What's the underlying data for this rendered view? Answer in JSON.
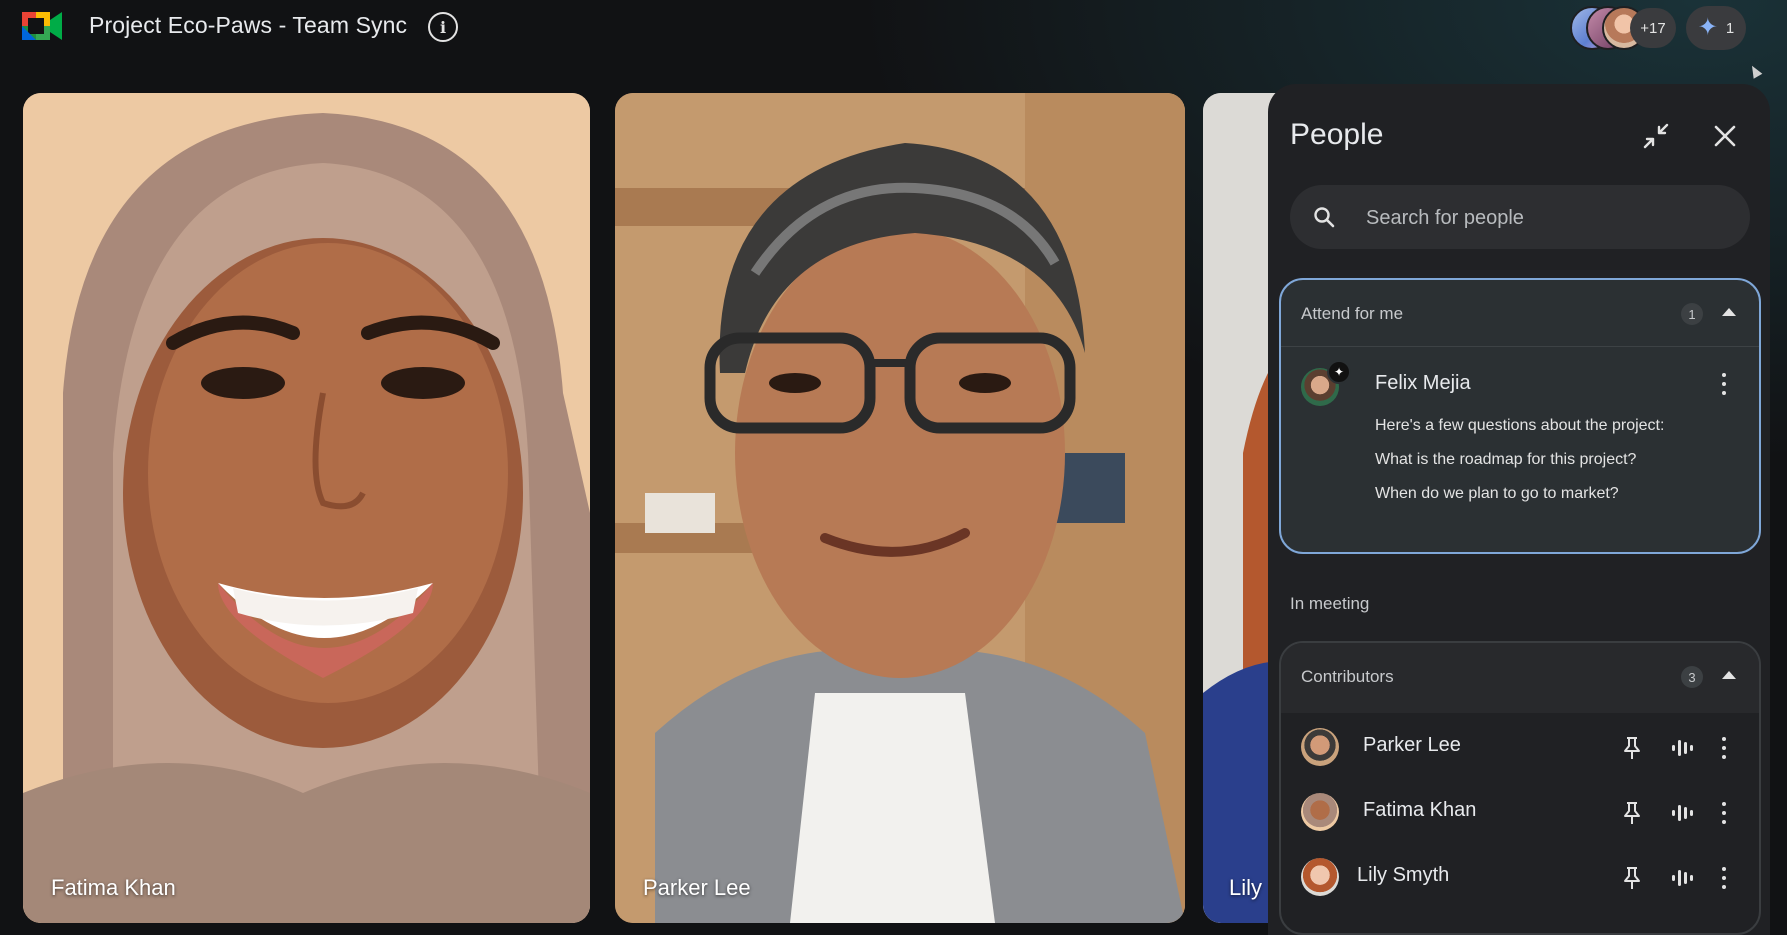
{
  "header": {
    "meeting_title": "Project Eco-Paws - Team Sync",
    "participants_more": "+17",
    "gemini_count": "1"
  },
  "tiles": [
    {
      "name": "Fatima Khan"
    },
    {
      "name": "Parker Lee"
    },
    {
      "name": "Lily"
    }
  ],
  "panel": {
    "title": "People",
    "search_placeholder": "Search for people",
    "attend": {
      "label": "Attend for me",
      "count": "1",
      "person": "Felix Mejia",
      "questions": [
        "Here's a few questions about the project:",
        "What is the roadmap for this project?",
        "When do we plan to go to market?"
      ]
    },
    "in_meeting_label": "In meeting",
    "contributors": {
      "label": "Contributors",
      "count": "3",
      "people": [
        {
          "name": "Parker Lee"
        },
        {
          "name": "Fatima Khan"
        },
        {
          "name": "Lily Smyth"
        }
      ]
    }
  },
  "colors": {
    "accent_blue": "#8ab4f8",
    "card_border": "#7fa7d8",
    "panel_bg": "#202124"
  }
}
